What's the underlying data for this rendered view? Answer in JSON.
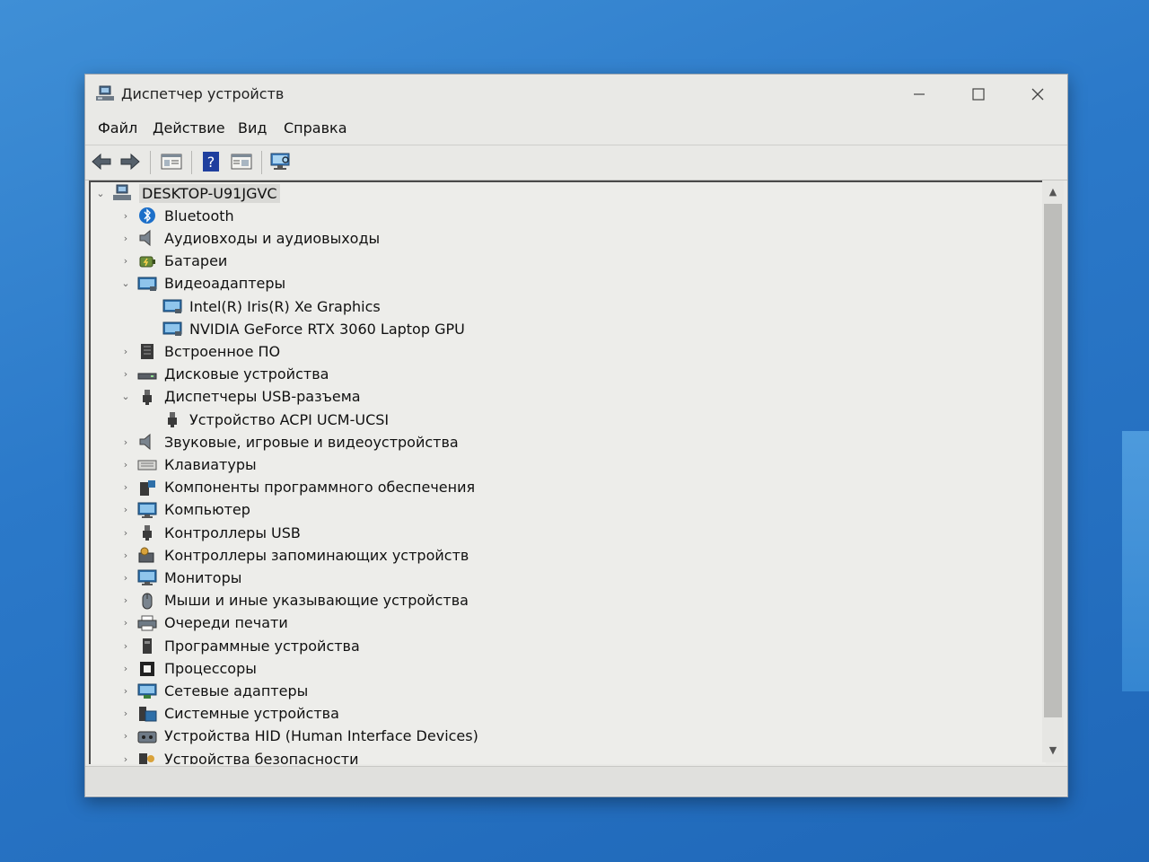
{
  "window": {
    "title": "Диспетчер устройств",
    "minimize_icon": "minimize-icon",
    "maximize_icon": "maximize-icon",
    "close_icon": "close-icon"
  },
  "menu": [
    {
      "label": "Файл"
    },
    {
      "label": "Действие"
    },
    {
      "label": "Вид"
    },
    {
      "label": "Справка"
    }
  ],
  "toolbar": [
    {
      "icon": "back-arrow-icon"
    },
    {
      "icon": "forward-arrow-icon"
    },
    {
      "icon": "properties-icon"
    },
    {
      "icon": "help-icon"
    },
    {
      "icon": "view-icon"
    },
    {
      "icon": "scan-hardware-icon"
    }
  ],
  "tree": [
    {
      "label": "DESKTOP-U91JGVC",
      "level": 0,
      "state": "expanded",
      "icon": "computer-icon",
      "root": true
    },
    {
      "label": "Bluetooth",
      "level": 1,
      "state": "collapsed",
      "icon": "bluetooth-icon"
    },
    {
      "label": "Аудиовходы и аудиовыходы",
      "level": 1,
      "state": "collapsed",
      "icon": "speaker-icon"
    },
    {
      "label": "Батареи",
      "level": 1,
      "state": "collapsed",
      "icon": "battery-icon"
    },
    {
      "label": "Видеоадаптеры",
      "level": 1,
      "state": "expanded",
      "icon": "display-adapter-icon"
    },
    {
      "label": "Intel(R) Iris(R) Xe Graphics",
      "level": 2,
      "state": "leaf",
      "icon": "display-adapter-icon"
    },
    {
      "label": "NVIDIA GeForce RTX 3060 Laptop GPU",
      "level": 2,
      "state": "leaf",
      "icon": "display-adapter-icon"
    },
    {
      "label": "Встроенное ПО",
      "level": 1,
      "state": "collapsed",
      "icon": "firmware-icon"
    },
    {
      "label": "Дисковые устройства",
      "level": 1,
      "state": "collapsed",
      "icon": "disk-icon"
    },
    {
      "label": "Диспетчеры USB-разъема",
      "level": 1,
      "state": "expanded",
      "icon": "usb-connector-icon"
    },
    {
      "label": "Устройство ACPI UCM-UCSI",
      "level": 2,
      "state": "leaf",
      "icon": "usb-connector-icon"
    },
    {
      "label": "Звуковые, игровые и видеоустройства",
      "level": 1,
      "state": "collapsed",
      "icon": "speaker-icon"
    },
    {
      "label": "Клавиатуры",
      "level": 1,
      "state": "collapsed",
      "icon": "keyboard-icon"
    },
    {
      "label": "Компоненты программного обеспечения",
      "level": 1,
      "state": "collapsed",
      "icon": "software-component-icon"
    },
    {
      "label": "Компьютер",
      "level": 1,
      "state": "collapsed",
      "icon": "monitor-icon"
    },
    {
      "label": "Контроллеры USB",
      "level": 1,
      "state": "collapsed",
      "icon": "usb-connector-icon"
    },
    {
      "label": "Контроллеры запоминающих устройств",
      "level": 1,
      "state": "collapsed",
      "icon": "storage-controller-icon"
    },
    {
      "label": "Мониторы",
      "level": 1,
      "state": "collapsed",
      "icon": "monitor-icon"
    },
    {
      "label": "Мыши и иные указывающие устройства",
      "level": 1,
      "state": "collapsed",
      "icon": "mouse-icon"
    },
    {
      "label": "Очереди печати",
      "level": 1,
      "state": "collapsed",
      "icon": "printer-icon"
    },
    {
      "label": "Программные устройства",
      "level": 1,
      "state": "collapsed",
      "icon": "software-device-icon"
    },
    {
      "label": "Процессоры",
      "level": 1,
      "state": "collapsed",
      "icon": "processor-icon"
    },
    {
      "label": "Сетевые адаптеры",
      "level": 1,
      "state": "collapsed",
      "icon": "network-adapter-icon"
    },
    {
      "label": "Системные устройства",
      "level": 1,
      "state": "collapsed",
      "icon": "system-device-icon"
    },
    {
      "label": "Устройства HID (Human Interface Devices)",
      "level": 1,
      "state": "collapsed",
      "icon": "hid-icon"
    },
    {
      "label": "Устройства безопасности",
      "level": 1,
      "state": "collapsed",
      "icon": "security-device-icon"
    }
  ],
  "colors": {
    "desktop": "#2b79c9",
    "window_bg": "#e9e9e6",
    "tree_bg": "#ededea",
    "selection": "#d9d9d6",
    "accent_blue": "#1c6fc9"
  }
}
